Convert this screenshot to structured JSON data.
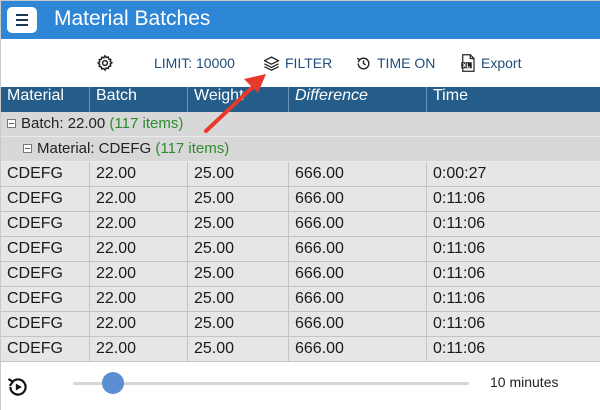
{
  "window": {
    "title": "Material Batches"
  },
  "toolbar": {
    "settings_icon": "gear-icon",
    "limit_label": "LIMIT: 10000",
    "filter_label": "FILTER",
    "time_label": "TIME ON",
    "export_label": "Export"
  },
  "grid": {
    "columns": [
      "Material",
      "Batch",
      "Weight",
      "Difference",
      "Time"
    ],
    "group_level1": {
      "label": "Batch: 22.00",
      "count": "(117 items)"
    },
    "group_level2": {
      "label": "Material: CDEFG",
      "count": "(117 items)"
    },
    "rows": [
      [
        "CDEFG",
        "22.00",
        "25.00",
        "666.00",
        "0:00:27"
      ],
      [
        "CDEFG",
        "22.00",
        "25.00",
        "666.00",
        "0:11:06"
      ],
      [
        "CDEFG",
        "22.00",
        "25.00",
        "666.00",
        "0:11:06"
      ],
      [
        "CDEFG",
        "22.00",
        "25.00",
        "666.00",
        "0:11:06"
      ],
      [
        "CDEFG",
        "22.00",
        "25.00",
        "666.00",
        "0:11:06"
      ],
      [
        "CDEFG",
        "22.00",
        "25.00",
        "666.00",
        "0:11:06"
      ],
      [
        "CDEFG",
        "22.00",
        "25.00",
        "666.00",
        "0:11:06"
      ],
      [
        "CDEFG",
        "22.00",
        "25.00",
        "666.00",
        "0:11:06"
      ]
    ]
  },
  "footer": {
    "slider_value_label": "10 minutes",
    "slider_fraction": 0.1
  },
  "colors": {
    "titlebar": "#2e86d6",
    "header": "#255d8a",
    "toolbar_text": "#1f4e79",
    "group_count": "#2e8b2e",
    "annotation_arrow": "#e8392b"
  }
}
